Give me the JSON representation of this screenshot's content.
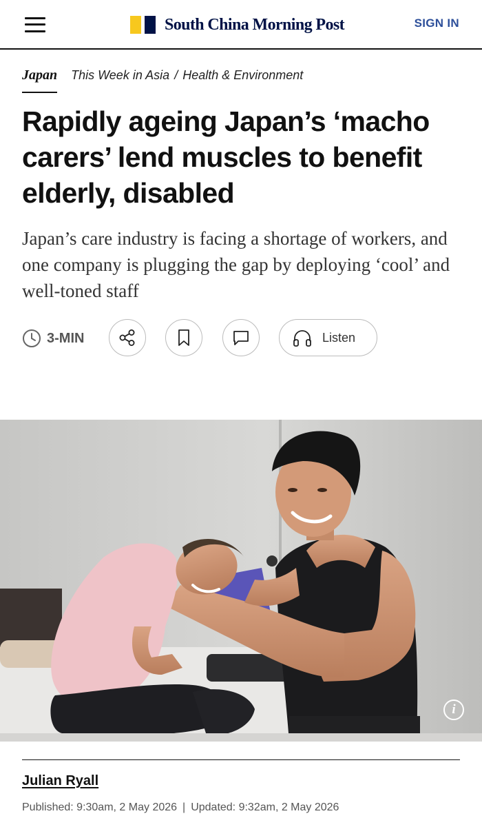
{
  "header": {
    "logo_text": "South China Morning Post",
    "signin_label": "SIGN IN",
    "brand_yellow": "#f7c81e",
    "brand_navy": "#001246"
  },
  "breadcrumb": {
    "section": "Japan",
    "links": [
      "This Week in Asia",
      "Health & Environment"
    ],
    "separator": "/"
  },
  "article": {
    "headline": "Rapidly ageing Japan’s ‘macho carers’ lend muscles to benefit elderly, disabled",
    "subheadline": "Japan’s care industry is facing a shortage of workers, and one company is plugging the gap by deploying ‘cool’ and well-toned staff"
  },
  "toolbar": {
    "read_time": "3-MIN",
    "listen_label": "Listen",
    "icons": [
      "clock-icon",
      "share-icon",
      "bookmark-icon",
      "comment-icon",
      "headphones-icon"
    ]
  },
  "photo": {
    "info_glyph": "i"
  },
  "byline": {
    "author": "Julian Ryall",
    "published": "Published: 9:30am, 2 May 2026",
    "updated": "Updated: 9:32am, 2 May 2026",
    "separator": "|"
  }
}
